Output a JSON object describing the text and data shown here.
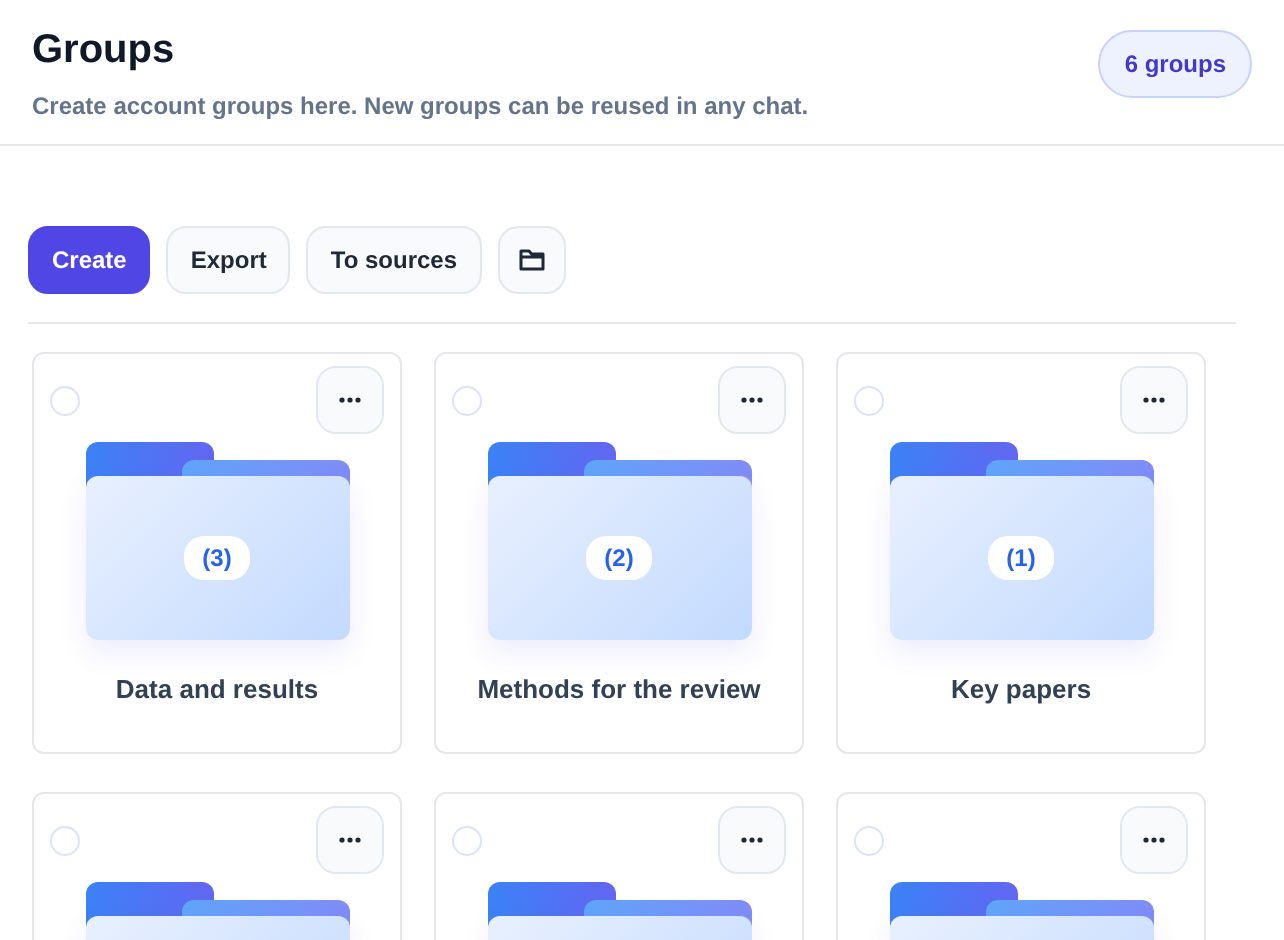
{
  "header": {
    "title": "Groups",
    "subtitle": "Create account groups here. New groups can be reused in any chat.",
    "count_badge": "6 groups"
  },
  "toolbar": {
    "buttons": [
      {
        "label": "Create",
        "kind": "primary"
      },
      {
        "label": "Export",
        "kind": "secondary"
      },
      {
        "label": "To sources",
        "kind": "secondary"
      },
      {
        "kind": "folder-icon"
      }
    ]
  },
  "groups": [
    {
      "name": "Data and results",
      "count": "(3)",
      "selected": false
    },
    {
      "name": "Methods for the review",
      "count": "(2)",
      "selected": false
    },
    {
      "name": "Key papers",
      "count": "(1)",
      "selected": false
    },
    {
      "selected": false
    },
    {
      "selected": false
    },
    {
      "selected": false
    }
  ]
}
